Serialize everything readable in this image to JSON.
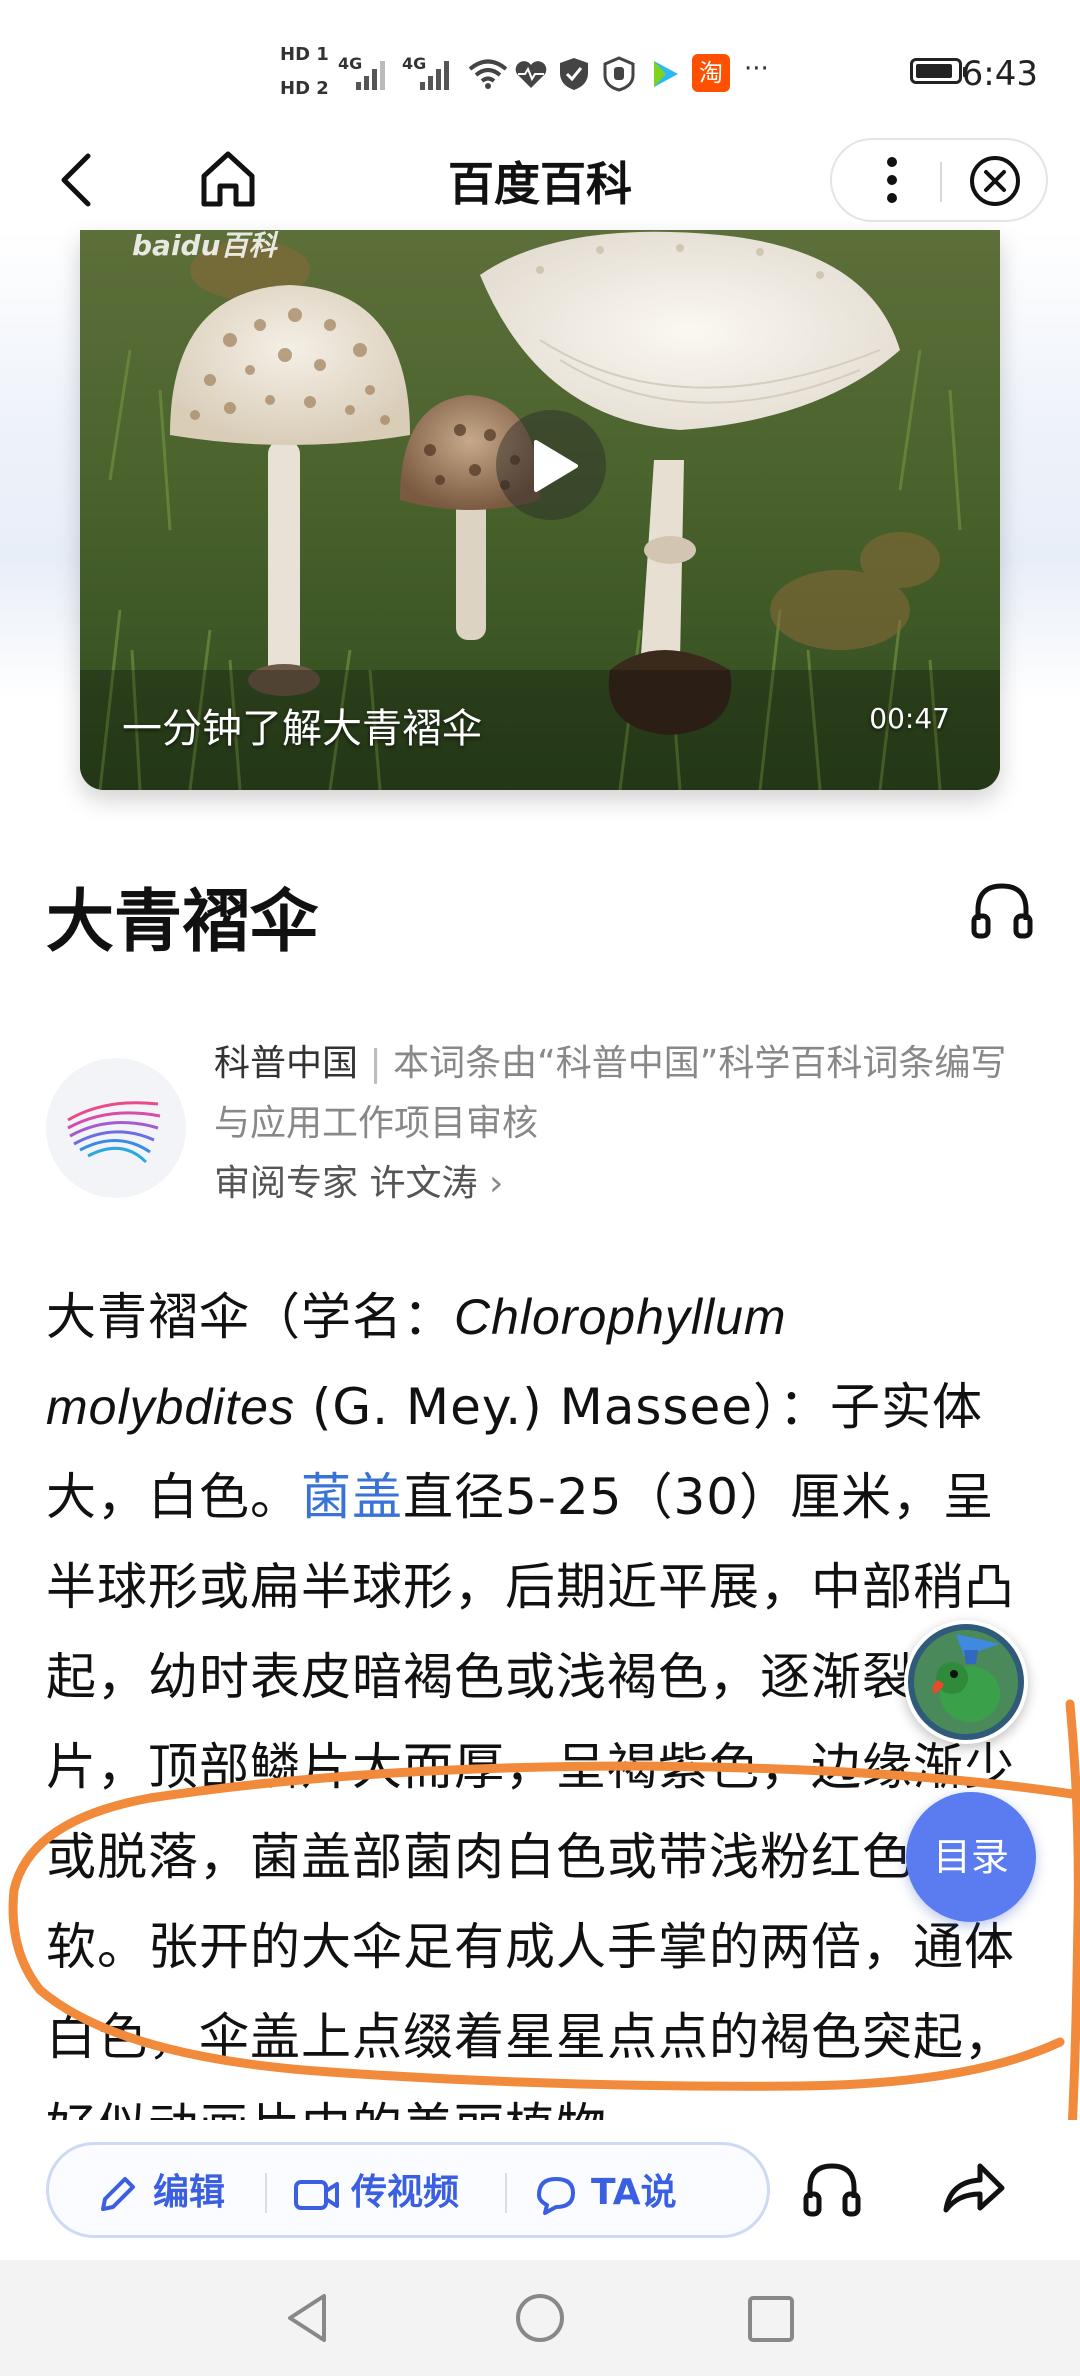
{
  "status_bar": {
    "time": "6:43",
    "sim1": "HD 1",
    "sim2": "HD 2",
    "network1": "4G",
    "network2": "4G",
    "more": "···",
    "app_badge": "淘",
    "battery_level": 0.85
  },
  "nav": {
    "title": "百度百科",
    "back_icon": "back-chevron-icon",
    "home_icon": "home-icon",
    "more_icon": "more-vertical-icon",
    "close_icon": "close-circle-icon"
  },
  "video": {
    "watermark": "baidu百科",
    "title": "一分钟了解大青褶伞",
    "duration": "00:47",
    "play_icon": "play-icon"
  },
  "entry": {
    "title": "大青褶伞",
    "listen_icon": "headphones-icon"
  },
  "source": {
    "name": "科普中国",
    "separator": "|",
    "description": "本词条由“科普中国”科学百科词条编写与应用工作项目审核",
    "reviewer_label": "审阅专家",
    "reviewer_name": "许文涛",
    "chevron": "›"
  },
  "body": {
    "p1_a": "大青褶伞（学名：",
    "p1_latin1": "Chlorophyllum",
    "p1_latin2": "molybdites",
    "p1_b": " (G. Mey.) Massee）：子实体大，白色。",
    "p1_link": "菌盖",
    "p1_c": "直径5-25（30）厘米，呈半球形或扁半球形，后期近平展，中部稍凸起，幼时表皮暗褐色或浅褐色，逐渐裂为鳞片，顶部鳞片大而厚，呈褐紫色，边缘渐少或脱落，菌盖部菌肉白色或带浅粉红色，松软。张开的大伞足有成人手掌的两倍，通体白色，伞盖上点缀着星星点点的褐色突起，好似动画片中的美丽植物。"
  },
  "floating": {
    "toc_label": "目录",
    "avatar_icon": "parrot-avatar-icon"
  },
  "toolbar": {
    "edit_label": "编辑",
    "video_label": "传视频",
    "talk_label": "TA说",
    "edit_icon": "pencil-icon",
    "video_icon": "video-camera-icon",
    "talk_icon": "chat-bubble-icon",
    "listen_icon": "headphones-icon",
    "share_icon": "share-arrow-icon"
  },
  "system_nav": {
    "back_icon": "triangle-back-icon",
    "home_icon": "circle-home-icon",
    "recents_icon": "square-recents-icon"
  },
  "colors": {
    "accent": "#3a5fe0",
    "link": "#3a73d8",
    "toc_button": "#5b7cf0",
    "annotation": "#f28a3c"
  }
}
